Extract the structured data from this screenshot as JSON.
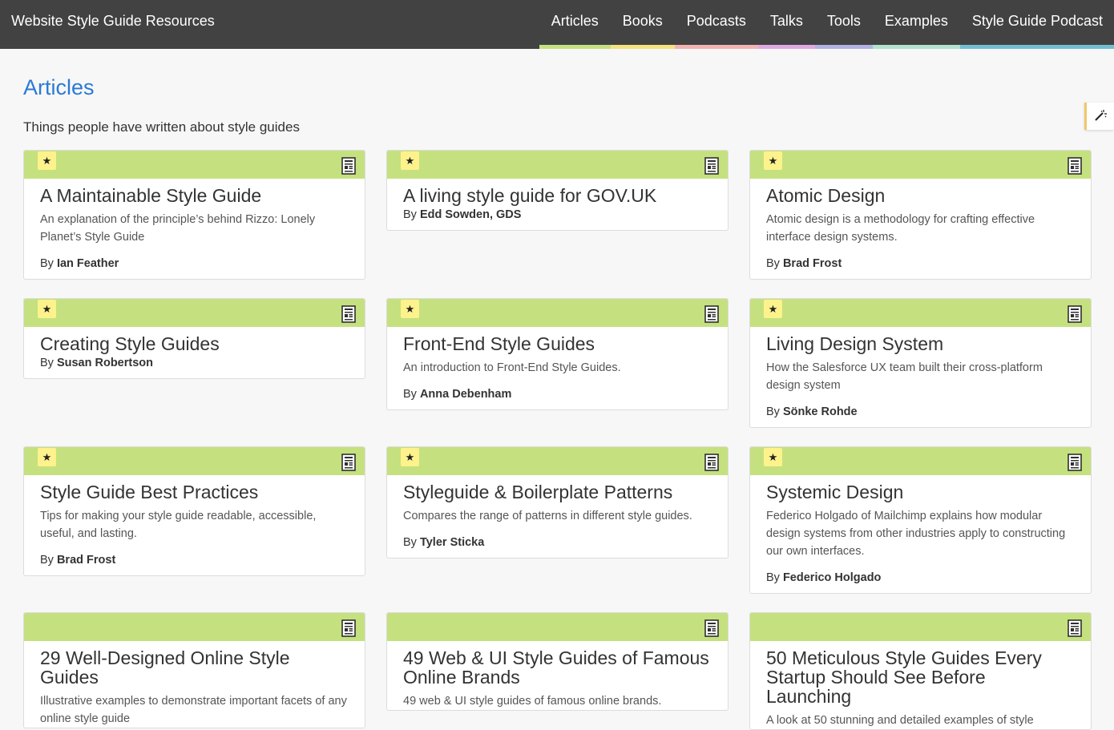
{
  "header": {
    "brand": "Website Style Guide Resources",
    "nav": [
      {
        "label": "Articles",
        "color": "#c5e17f"
      },
      {
        "label": "Books",
        "color": "#f3e37f"
      },
      {
        "label": "Podcasts",
        "color": "#f3b3b3"
      },
      {
        "label": "Talks",
        "color": "#e0a9e0"
      },
      {
        "label": "Tools",
        "color": "#b1b1e3"
      },
      {
        "label": "Examples",
        "color": "#b1e3cf"
      },
      {
        "label": "Style Guide Podcast",
        "color": "#71bfd1"
      }
    ]
  },
  "page": {
    "title": "Articles",
    "subtitle": "Things people have written about style guides"
  },
  "by_prefix": "By",
  "colors": {
    "band": "#c5e17f",
    "star_badge": "#fdf28b",
    "title_link": "#2a7ad6",
    "header_bg": "#424242"
  },
  "icons": {
    "featured": "star-icon",
    "type": "document-icon",
    "tools": "magic-wand-icon"
  },
  "cards": [
    {
      "title": "A Maintainable Style Guide",
      "desc": "An explanation of the principle’s behind Rizzo: Lonely Planet’s Style Guide",
      "author": "Ian Feather",
      "featured": true
    },
    {
      "title": "A living style guide for GOV.UK",
      "desc": "",
      "author": "Edd Sowden, GDS",
      "featured": true
    },
    {
      "title": "Atomic Design",
      "desc": "Atomic design is a methodology for crafting effective interface design systems.",
      "author": "Brad Frost",
      "featured": true
    },
    {
      "title": "Creating Style Guides",
      "desc": "",
      "author": "Susan Robertson",
      "featured": true
    },
    {
      "title": "Front-End Style Guides",
      "desc": "An introduction to Front-End Style Guides.",
      "author": "Anna Debenham",
      "featured": true
    },
    {
      "title": "Living Design System",
      "desc": "How the Salesforce UX team built their cross-platform design system",
      "author": "Sönke Rohde",
      "featured": true
    },
    {
      "title": "Style Guide Best Practices",
      "desc": "Tips for making your style guide readable, accessible, useful, and lasting.",
      "author": "Brad Frost",
      "featured": true
    },
    {
      "title": "Styleguide & Boilerplate Patterns",
      "desc": "Compares the range of patterns in different style guides.",
      "author": "Tyler Sticka",
      "featured": true
    },
    {
      "title": "Systemic Design",
      "desc": "Federico Holgado of Mailchimp explains how modular design systems from other industries apply to constructing our own interfaces.",
      "author": "Federico Holgado",
      "featured": true
    },
    {
      "title": "29 Well-Designed Online Style Guides",
      "desc": "Illustrative examples to demonstrate important facets of any online style guide",
      "author": "",
      "featured": false
    },
    {
      "title": "49 Web & UI Style Guides of Famous Online Brands",
      "desc": "49 web & UI style guides of famous online brands.",
      "author": "",
      "featured": false
    },
    {
      "title": "50 Meticulous Style Guides Every Startup Should See Before Launching",
      "desc": "A look at 50 stunning and detailed examples of style",
      "author": "",
      "featured": false
    }
  ]
}
